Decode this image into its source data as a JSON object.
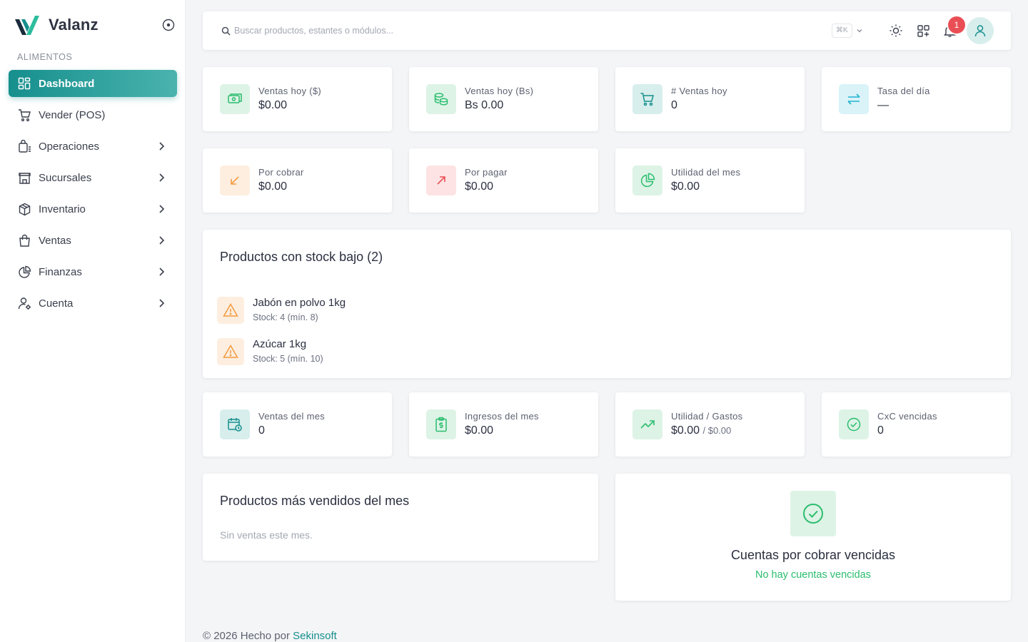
{
  "brand": {
    "name": "Valanz"
  },
  "sidebar": {
    "section_label": "ALIMENTOS",
    "items": [
      {
        "label": "Dashboard",
        "icon": "dashboard-icon"
      },
      {
        "label": "Vender (POS)",
        "icon": "cart-icon"
      },
      {
        "label": "Operaciones",
        "icon": "operations-icon"
      },
      {
        "label": "Sucursales",
        "icon": "store-icon"
      },
      {
        "label": "Inventario",
        "icon": "box-icon"
      },
      {
        "label": "Ventas",
        "icon": "shopping-bag-icon"
      },
      {
        "label": "Finanzas",
        "icon": "pie-chart-icon"
      },
      {
        "label": "Cuenta",
        "icon": "user-settings-icon"
      }
    ]
  },
  "topbar": {
    "search_placeholder": "Buscar productos, estantes o módulos...",
    "shortcut": "⌘K",
    "notifications_count": "1"
  },
  "stats_top": [
    {
      "label": "Ventas hoy ($)",
      "value": "$0.00"
    },
    {
      "label": "Ventas hoy (Bs)",
      "value": "Bs 0.00"
    },
    {
      "label": "# Ventas hoy",
      "value": "0"
    },
    {
      "label": "Tasa del día",
      "value": "—"
    },
    {
      "label": "Por cobrar",
      "value": "$0.00"
    },
    {
      "label": "Por pagar",
      "value": "$0.00"
    },
    {
      "label": "Utilidad del mes",
      "value": "$0.00"
    }
  ],
  "low_stock": {
    "title": "Productos con stock bajo (2)",
    "items": [
      {
        "name": "Jabón en polvo 1kg",
        "stock": "Stock: 4 (mín. 8)"
      },
      {
        "name": "Azúcar 1kg",
        "stock": "Stock: 5 (mín. 10)"
      }
    ]
  },
  "stats_month": [
    {
      "label": "Ventas del mes",
      "value": "0"
    },
    {
      "label": "Ingresos del mes",
      "value": "$0.00"
    },
    {
      "label": "Utilidad / Gastos",
      "value": "$0.00",
      "sub": "/ $0.00"
    },
    {
      "label": "CxC vencidas",
      "value": "0"
    }
  ],
  "top_products": {
    "title": "Productos más vendidos del mes",
    "empty": "Sin ventas este mes."
  },
  "overdue": {
    "title": "Cuentas por cobrar vencidas",
    "message": "No hay cuentas vencidas"
  },
  "footer": {
    "text": "© 2026 Hecho por",
    "link": "Sekinsoft"
  },
  "colors": {
    "accent": "#168f8d",
    "green_bg": "#ddf3e6",
    "green": "#2bbd6e",
    "teal_bg": "#d7eeec",
    "teal": "#168f8d",
    "cyan_bg": "#d9f3f8",
    "cyan": "#22b3cf",
    "orange_bg": "#fdeee0",
    "orange": "#f39a3d",
    "red_bg": "#fde3e4",
    "red": "#ea4e55"
  }
}
